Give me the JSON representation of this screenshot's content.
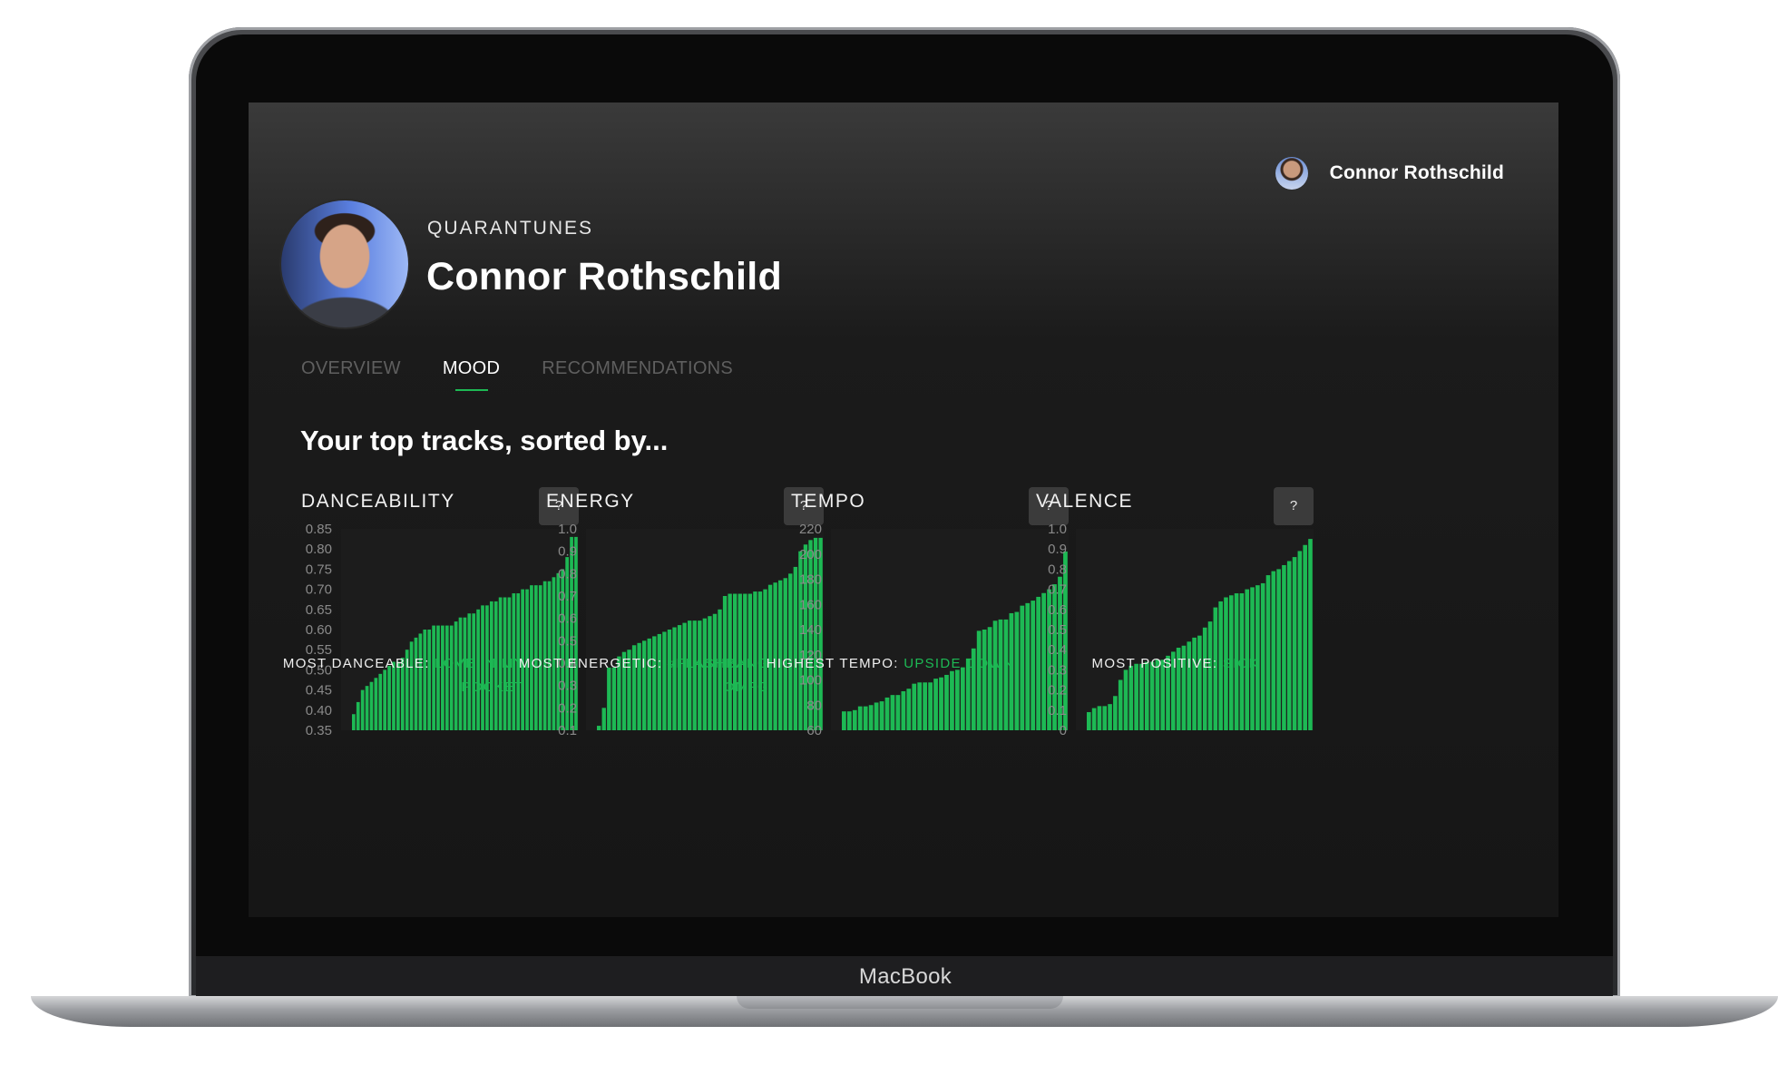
{
  "device": {
    "brand": "MacBook"
  },
  "header": {
    "user_name": "Connor Rothschild"
  },
  "profile": {
    "eyebrow": "QUARANTUNES",
    "name": "Connor Rothschild"
  },
  "tabs": [
    {
      "label": "OVERVIEW",
      "active": false
    },
    {
      "label": "MOOD",
      "active": true
    },
    {
      "label": "RECOMMENDATIONS",
      "active": false
    }
  ],
  "section_title": "Your top tracks, sorted by...",
  "colors": {
    "accent": "#1db954",
    "background": "#161616",
    "muted_text": "#5f5f5f",
    "help_button": "#3b3b3b"
  },
  "panels": [
    {
      "title": "DANCEABILITY",
      "help": "?",
      "caption_label": "MOST DANCEABLE:",
      "caption_track": "LOVE IN MY POCKET"
    },
    {
      "title": "ENERGY",
      "help": "?",
      "caption_label": "MOST ENERGETIC:",
      "caption_track": "#FLASHBANG OMFG"
    },
    {
      "title": "TEMPO",
      "help": "?",
      "caption_label": "HIGHEST TEMPO:",
      "caption_track": "UPSIDE DOWN"
    },
    {
      "title": "VALENCE",
      "help": "?",
      "caption_label": "MOST POSITIVE:",
      "caption_track": "SICK"
    }
  ],
  "chart_data": [
    {
      "type": "bar",
      "title": "DANCEABILITY",
      "ylim": [
        0.35,
        0.85
      ],
      "yticks": [
        "0.85",
        "0.80",
        "0.75",
        "0.70",
        "0.65",
        "0.60",
        "0.55",
        "0.50",
        "0.45",
        "0.40",
        "0.35"
      ],
      "values": [
        0.39,
        0.42,
        0.45,
        0.46,
        0.47,
        0.48,
        0.49,
        0.5,
        0.51,
        0.52,
        0.52,
        0.53,
        0.55,
        0.57,
        0.58,
        0.59,
        0.6,
        0.6,
        0.61,
        0.61,
        0.61,
        0.61,
        0.61,
        0.62,
        0.63,
        0.63,
        0.64,
        0.64,
        0.65,
        0.66,
        0.66,
        0.67,
        0.67,
        0.68,
        0.68,
        0.68,
        0.69,
        0.69,
        0.7,
        0.7,
        0.71,
        0.71,
        0.71,
        0.72,
        0.72,
        0.73,
        0.74,
        0.75,
        0.78,
        0.83,
        0.83
      ]
    },
    {
      "type": "bar",
      "title": "ENERGY",
      "ylim": [
        0.1,
        1.0
      ],
      "yticks": [
        "1.0",
        "0.9",
        "0.8",
        "0.7",
        "0.6",
        "0.5",
        "0.4",
        "0.3",
        "0.2",
        "0.1"
      ],
      "values": [
        0.12,
        0.2,
        0.38,
        0.38,
        0.43,
        0.45,
        0.46,
        0.48,
        0.49,
        0.5,
        0.51,
        0.52,
        0.53,
        0.54,
        0.55,
        0.56,
        0.57,
        0.58,
        0.59,
        0.59,
        0.59,
        0.6,
        0.61,
        0.62,
        0.64,
        0.7,
        0.71,
        0.71,
        0.71,
        0.71,
        0.71,
        0.72,
        0.72,
        0.73,
        0.75,
        0.76,
        0.77,
        0.78,
        0.8,
        0.83,
        0.9,
        0.93,
        0.95,
        0.96,
        0.96
      ]
    },
    {
      "type": "bar",
      "title": "TEMPO",
      "ylim": [
        60,
        220
      ],
      "yticks": [
        "220",
        "200",
        "180",
        "160",
        "140",
        "120",
        "100",
        "80",
        "60"
      ],
      "values": [
        75,
        75,
        76,
        79,
        79,
        80,
        82,
        83,
        86,
        88,
        88,
        91,
        93,
        97,
        98,
        98,
        98,
        101,
        102,
        104,
        107,
        108,
        110,
        117,
        125,
        139,
        140,
        142,
        147,
        148,
        148,
        153,
        154,
        159,
        161,
        163,
        166,
        169,
        172,
        176,
        182,
        202
      ]
    },
    {
      "type": "bar",
      "title": "VALENCE",
      "ylim": [
        0,
        1.0
      ],
      "yticks": [
        "1.0",
        "0.9",
        "0.8",
        "0.7",
        "0.6",
        "0.5",
        "0.4",
        "0.3",
        "0.2",
        "0.1",
        "0"
      ],
      "values": [
        0.09,
        0.11,
        0.12,
        0.12,
        0.13,
        0.17,
        0.25,
        0.3,
        0.32,
        0.33,
        0.33,
        0.34,
        0.34,
        0.35,
        0.35,
        0.37,
        0.39,
        0.41,
        0.42,
        0.44,
        0.46,
        0.47,
        0.51,
        0.54,
        0.61,
        0.64,
        0.66,
        0.67,
        0.68,
        0.68,
        0.7,
        0.71,
        0.72,
        0.73,
        0.77,
        0.79,
        0.8,
        0.82,
        0.84,
        0.86,
        0.89,
        0.92,
        0.95
      ]
    }
  ]
}
